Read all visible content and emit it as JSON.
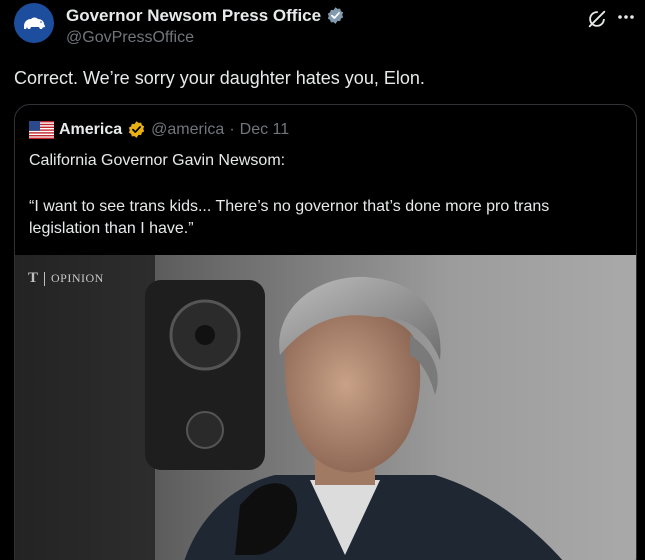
{
  "author": {
    "name": "Governor Newsom Press Office",
    "handle": "@GovPressOffice",
    "verified_badge_color": "#829aab"
  },
  "icons": {
    "grok": "grok-icon",
    "more": "more-icon",
    "verified": "verified-badge-icon"
  },
  "tweet": {
    "text": "Correct. We’re sorry your daughter hates you, Elon."
  },
  "quote": {
    "author_name": "America",
    "author_handle": "@america",
    "separator": "·",
    "date": "Dec 11",
    "badge_color": "#e8b015",
    "line1": "California Governor Gavin Newsom:",
    "line2": "“I want to see trans kids... There’s no governor that’s done more pro trans legislation than I have.”",
    "image": {
      "watermark_logo": "T",
      "watermark_label": "OPINION"
    }
  },
  "colors": {
    "background": "#000000",
    "text": "#e7e9ea",
    "secondary": "#71767b",
    "border": "#2f3336"
  }
}
